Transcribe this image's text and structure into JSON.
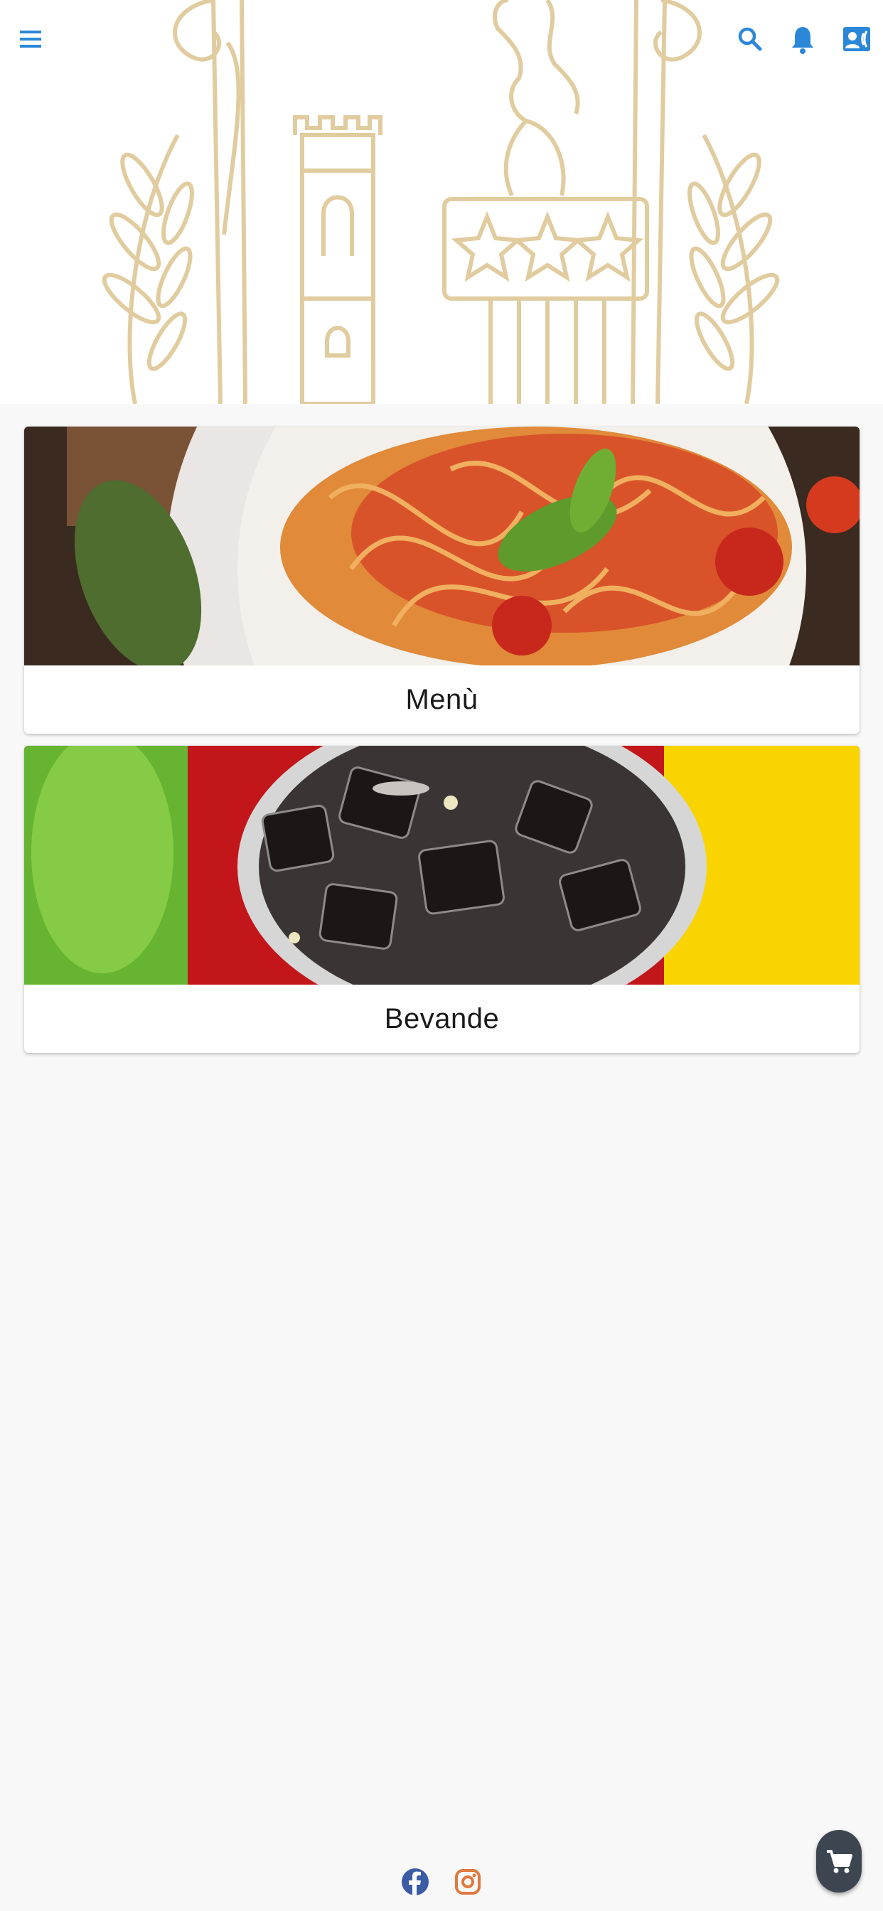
{
  "header": {
    "menu_icon": "hamburger-menu-icon",
    "search_icon": "search-icon",
    "notification_icon": "bell-icon",
    "contact_icon": "contact-card-icon",
    "accent_color": "#2b87d8",
    "crest_color": "#d9c089"
  },
  "categories": [
    {
      "label": "Menù",
      "image": "pasta-photo"
    },
    {
      "label": "Bevande",
      "image": "drinks-photo"
    }
  ],
  "footer": {
    "facebook_icon": "facebook-icon",
    "instagram_icon": "instagram-icon",
    "cart_icon": "cart-icon",
    "facebook_color": "#3b5ba5",
    "instagram_color": "#e0793f"
  }
}
